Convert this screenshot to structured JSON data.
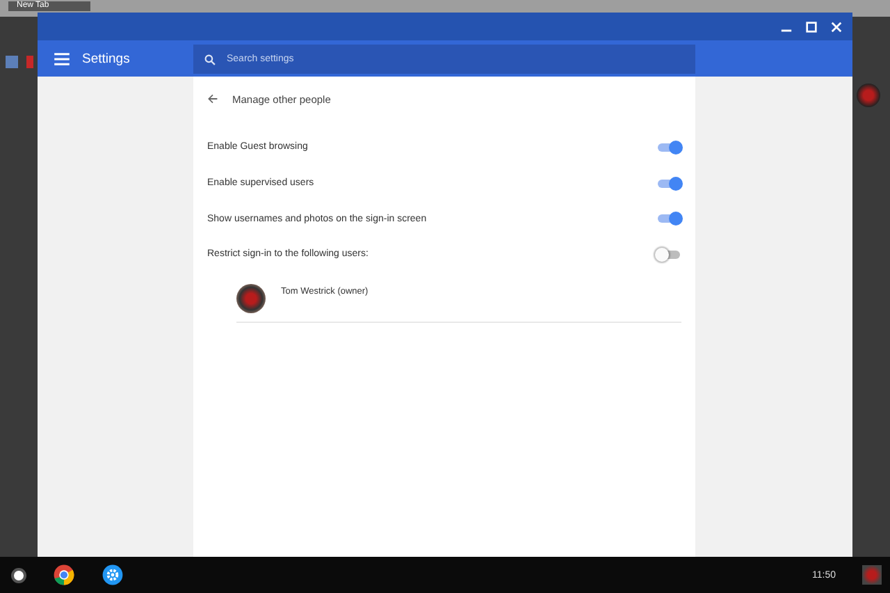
{
  "background_tab": {
    "title": "New Tab"
  },
  "window": {
    "title": "Settings"
  },
  "search": {
    "placeholder": "Search settings"
  },
  "page": {
    "title": "Manage other people"
  },
  "settings": [
    {
      "label": "Enable Guest browsing",
      "on": true
    },
    {
      "label": "Enable supervised users",
      "on": true
    },
    {
      "label": "Show usernames and photos on the sign-in screen",
      "on": true
    },
    {
      "label": "Restrict sign-in to the following users:",
      "on": false
    }
  ],
  "users": [
    {
      "name": "Tom Westrick (owner)"
    }
  ],
  "shelf": {
    "time": "11:50"
  }
}
